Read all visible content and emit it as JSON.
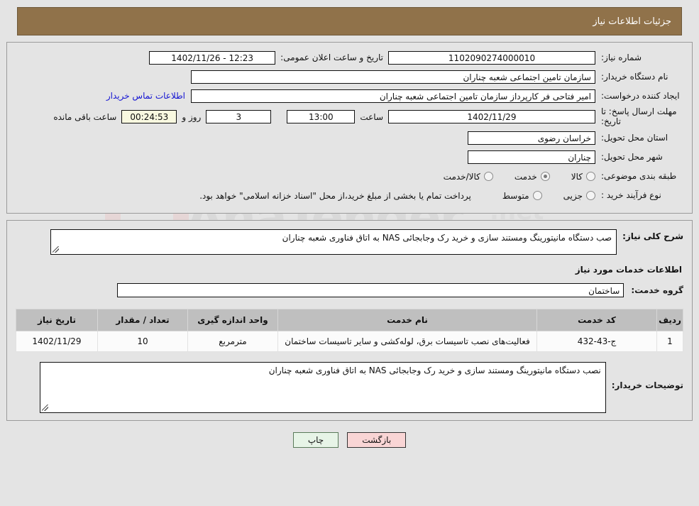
{
  "header": {
    "title": "جزئیات اطلاعات نیاز",
    "bg_color": "#90724a"
  },
  "top_form": {
    "need_number_label": "شماره نیاز:",
    "need_number_value": "1102090274000010",
    "announce_label": "تاریخ و ساعت اعلان عمومی:",
    "announce_value": "12:23 - 1402/11/26",
    "buyer_org_label": "نام دستگاه خریدار:",
    "buyer_org_value": "سازمان تامین اجتماعی شعبه چناران",
    "creator_label": "ایجاد کننده درخواست:",
    "creator_value": "امیر فتاحی فر کارپرداز سازمان تامین اجتماعی شعبه چناران",
    "contact_link": "اطلاعات تماس خریدار",
    "deadline_label": "مهلت ارسال پاسخ: تا تاریخ:",
    "deadline_date": "1402/11/29",
    "hour_label": "ساعت",
    "deadline_time": "13:00",
    "days_value": "3",
    "days_label": "روز و",
    "countdown_value": "00:24:53",
    "countdown_label": "ساعت باقی مانده",
    "province_label": "استان محل تحویل:",
    "province_value": "خراسان رضوی",
    "city_label": "شهر محل تحویل:",
    "city_value": "چناران",
    "category_label": "طبقه بندی موضوعی:",
    "category_options": [
      {
        "label": "کالا",
        "selected": false
      },
      {
        "label": "خدمت",
        "selected": true
      },
      {
        "label": "کالا/خدمت",
        "selected": false
      }
    ],
    "process_label": "نوع فرآیند خرید :",
    "process_options": [
      {
        "label": "جزیی",
        "selected": false
      },
      {
        "label": "متوسط",
        "selected": false
      }
    ],
    "process_note": "پرداخت تمام یا بخشی از مبلغ خرید،از محل \"اسناد خزانه اسلامی\" خواهد بود."
  },
  "summary": {
    "label": "شرح کلی نیاز:",
    "value": "صب دستگاه مانیتورینگ ومستند سازی و خرید رک وجابجائی NAS به اتاق فناوری شعبه چناران"
  },
  "services_section": {
    "heading": "اطلاعات خدمات مورد نیاز",
    "group_label": "گروه خدمت:",
    "group_value": "ساختمان",
    "table": {
      "columns": [
        "ردیف",
        "کد خدمت",
        "نام خدمت",
        "واحد اندازه گیری",
        "تعداد / مقدار",
        "تاریخ نیاز"
      ],
      "rows": [
        {
          "radif": "1",
          "code": "ج-43-432",
          "name": "فعالیت‌های نصب تاسیسات برق، لوله‌کشی و سایر تاسیسات ساختمان",
          "unit": "مترمربع",
          "qty": "10",
          "date": "1402/11/29"
        }
      ]
    }
  },
  "buyer_notes": {
    "label": "توضیحات خریدار:",
    "value": "نصب دستگاه مانیتورینگ ومستند سازی و خرید رک وجابجائی NAS به اتاق فناوری شعبه چناران"
  },
  "footer": {
    "print_label": "چاپ",
    "back_label": "بازگشت"
  },
  "watermark": {
    "brand": "AnaTender",
    "suffix": ".net"
  }
}
